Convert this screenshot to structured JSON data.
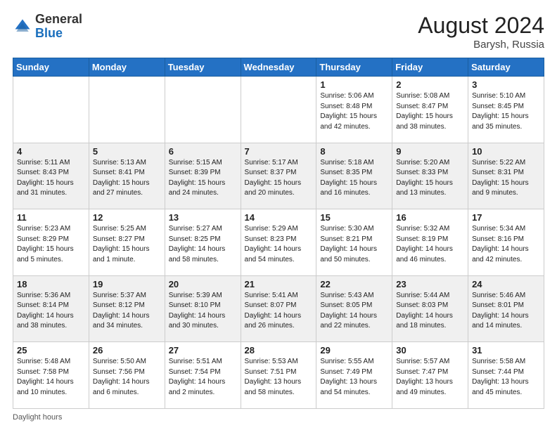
{
  "header": {
    "logo_general": "General",
    "logo_blue": "Blue",
    "month_year": "August 2024",
    "location": "Barysh, Russia"
  },
  "footer": {
    "daylight_hours": "Daylight hours"
  },
  "days_of_week": [
    "Sunday",
    "Monday",
    "Tuesday",
    "Wednesday",
    "Thursday",
    "Friday",
    "Saturday"
  ],
  "weeks": [
    [
      {
        "day": "",
        "info": ""
      },
      {
        "day": "",
        "info": ""
      },
      {
        "day": "",
        "info": ""
      },
      {
        "day": "",
        "info": ""
      },
      {
        "day": "1",
        "info": "Sunrise: 5:06 AM\nSunset: 8:48 PM\nDaylight: 15 hours and 42 minutes."
      },
      {
        "day": "2",
        "info": "Sunrise: 5:08 AM\nSunset: 8:47 PM\nDaylight: 15 hours and 38 minutes."
      },
      {
        "day": "3",
        "info": "Sunrise: 5:10 AM\nSunset: 8:45 PM\nDaylight: 15 hours and 35 minutes."
      }
    ],
    [
      {
        "day": "4",
        "info": "Sunrise: 5:11 AM\nSunset: 8:43 PM\nDaylight: 15 hours and 31 minutes."
      },
      {
        "day": "5",
        "info": "Sunrise: 5:13 AM\nSunset: 8:41 PM\nDaylight: 15 hours and 27 minutes."
      },
      {
        "day": "6",
        "info": "Sunrise: 5:15 AM\nSunset: 8:39 PM\nDaylight: 15 hours and 24 minutes."
      },
      {
        "day": "7",
        "info": "Sunrise: 5:17 AM\nSunset: 8:37 PM\nDaylight: 15 hours and 20 minutes."
      },
      {
        "day": "8",
        "info": "Sunrise: 5:18 AM\nSunset: 8:35 PM\nDaylight: 15 hours and 16 minutes."
      },
      {
        "day": "9",
        "info": "Sunrise: 5:20 AM\nSunset: 8:33 PM\nDaylight: 15 hours and 13 minutes."
      },
      {
        "day": "10",
        "info": "Sunrise: 5:22 AM\nSunset: 8:31 PM\nDaylight: 15 hours and 9 minutes."
      }
    ],
    [
      {
        "day": "11",
        "info": "Sunrise: 5:23 AM\nSunset: 8:29 PM\nDaylight: 15 hours and 5 minutes."
      },
      {
        "day": "12",
        "info": "Sunrise: 5:25 AM\nSunset: 8:27 PM\nDaylight: 15 hours and 1 minute."
      },
      {
        "day": "13",
        "info": "Sunrise: 5:27 AM\nSunset: 8:25 PM\nDaylight: 14 hours and 58 minutes."
      },
      {
        "day": "14",
        "info": "Sunrise: 5:29 AM\nSunset: 8:23 PM\nDaylight: 14 hours and 54 minutes."
      },
      {
        "day": "15",
        "info": "Sunrise: 5:30 AM\nSunset: 8:21 PM\nDaylight: 14 hours and 50 minutes."
      },
      {
        "day": "16",
        "info": "Sunrise: 5:32 AM\nSunset: 8:19 PM\nDaylight: 14 hours and 46 minutes."
      },
      {
        "day": "17",
        "info": "Sunrise: 5:34 AM\nSunset: 8:16 PM\nDaylight: 14 hours and 42 minutes."
      }
    ],
    [
      {
        "day": "18",
        "info": "Sunrise: 5:36 AM\nSunset: 8:14 PM\nDaylight: 14 hours and 38 minutes."
      },
      {
        "day": "19",
        "info": "Sunrise: 5:37 AM\nSunset: 8:12 PM\nDaylight: 14 hours and 34 minutes."
      },
      {
        "day": "20",
        "info": "Sunrise: 5:39 AM\nSunset: 8:10 PM\nDaylight: 14 hours and 30 minutes."
      },
      {
        "day": "21",
        "info": "Sunrise: 5:41 AM\nSunset: 8:07 PM\nDaylight: 14 hours and 26 minutes."
      },
      {
        "day": "22",
        "info": "Sunrise: 5:43 AM\nSunset: 8:05 PM\nDaylight: 14 hours and 22 minutes."
      },
      {
        "day": "23",
        "info": "Sunrise: 5:44 AM\nSunset: 8:03 PM\nDaylight: 14 hours and 18 minutes."
      },
      {
        "day": "24",
        "info": "Sunrise: 5:46 AM\nSunset: 8:01 PM\nDaylight: 14 hours and 14 minutes."
      }
    ],
    [
      {
        "day": "25",
        "info": "Sunrise: 5:48 AM\nSunset: 7:58 PM\nDaylight: 14 hours and 10 minutes."
      },
      {
        "day": "26",
        "info": "Sunrise: 5:50 AM\nSunset: 7:56 PM\nDaylight: 14 hours and 6 minutes."
      },
      {
        "day": "27",
        "info": "Sunrise: 5:51 AM\nSunset: 7:54 PM\nDaylight: 14 hours and 2 minutes."
      },
      {
        "day": "28",
        "info": "Sunrise: 5:53 AM\nSunset: 7:51 PM\nDaylight: 13 hours and 58 minutes."
      },
      {
        "day": "29",
        "info": "Sunrise: 5:55 AM\nSunset: 7:49 PM\nDaylight: 13 hours and 54 minutes."
      },
      {
        "day": "30",
        "info": "Sunrise: 5:57 AM\nSunset: 7:47 PM\nDaylight: 13 hours and 49 minutes."
      },
      {
        "day": "31",
        "info": "Sunrise: 5:58 AM\nSunset: 7:44 PM\nDaylight: 13 hours and 45 minutes."
      }
    ]
  ]
}
